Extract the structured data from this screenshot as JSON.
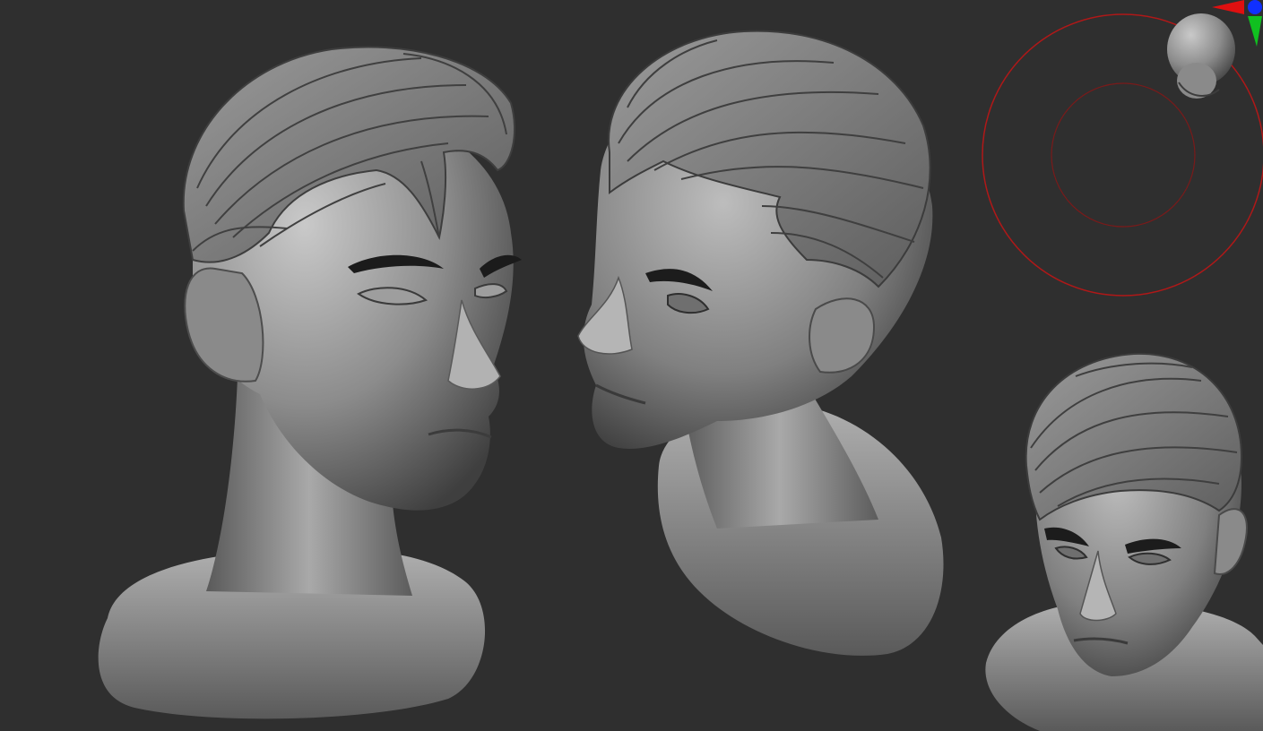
{
  "viewport": {
    "background": "#2f2f2f"
  },
  "models": [
    {
      "name": "bust-three-quarter-view",
      "material": "matcap-gray"
    },
    {
      "name": "bust-low-angle-view",
      "material": "matcap-gray"
    },
    {
      "name": "bust-high-angle-view",
      "material": "matcap-gray"
    }
  ],
  "gizmo": {
    "ring_color": "#b01818",
    "axis_colors": {
      "x": "#e01010",
      "y": "#10c020",
      "z": "#1030ff"
    },
    "orientation_icon": "skull-icon"
  }
}
